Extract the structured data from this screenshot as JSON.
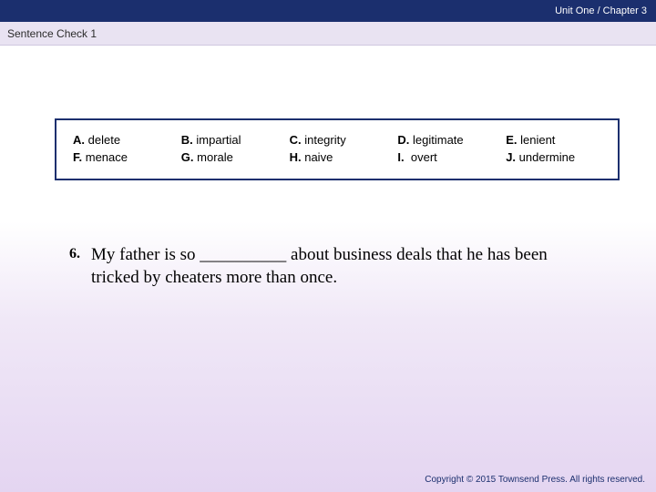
{
  "header": {
    "breadcrumb": "Unit One / Chapter 3",
    "subtitle": "Sentence Check 1"
  },
  "wordbank": {
    "A": {
      "letter": "A.",
      "word": "delete"
    },
    "B": {
      "letter": "B.",
      "word": "impartial"
    },
    "C": {
      "letter": "C.",
      "word": "integrity"
    },
    "D": {
      "letter": "D.",
      "word": "legitimate"
    },
    "E": {
      "letter": "E.",
      "word": "lenient"
    },
    "F": {
      "letter": "F.",
      "word": "menace"
    },
    "G": {
      "letter": "G.",
      "word": "morale"
    },
    "H": {
      "letter": "H.",
      "word": "naive"
    },
    "I": {
      "letter": "I.",
      "word": "overt"
    },
    "J": {
      "letter": "J.",
      "word": "undermine"
    }
  },
  "question": {
    "number": "6.",
    "text": "My father is so __________ about business deals that he has been tricked by cheaters more than once."
  },
  "footer": {
    "copyright": "Copyright © 2015 Townsend Press. All rights reserved."
  }
}
